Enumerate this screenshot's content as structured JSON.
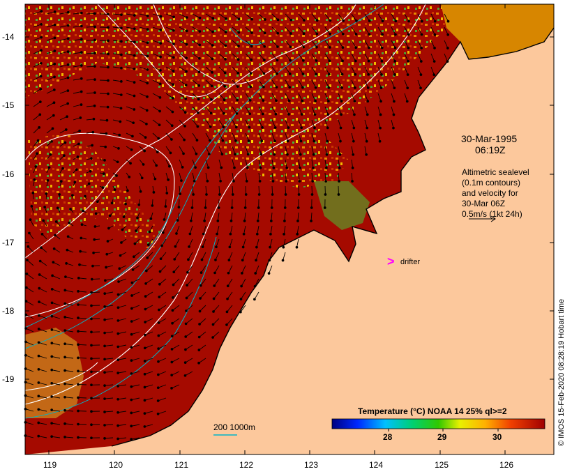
{
  "map": {
    "date": "30-Mar-1995",
    "time": "06:19Z",
    "legend_lines": [
      "Altimetric sealevel",
      "(0.1m contours)",
      "and velocity for",
      "30-Mar 06Z",
      "0.5m/s (1kt 24h)"
    ],
    "drifter_label": "drifter",
    "scale_label": "200  1000m",
    "credit": "© IMOS 15-Feb-2020 08:28:19 Hobart time",
    "colorbar": {
      "title": "Temperature (°C) NOAA 14 25% ql>=2",
      "ticks": [
        "28",
        "29",
        "30"
      ]
    },
    "lat_labels": [
      "-14",
      "-15",
      "-16",
      "-17",
      "-18",
      "-19"
    ],
    "lon_labels": [
      "119",
      "120",
      "121",
      "122",
      "123",
      "124",
      "125",
      "126"
    ],
    "colors": {
      "land": "#fcc89c",
      "sea_warm": "#a50a00",
      "contour": "#ffffff",
      "isobath": "#00b4c8",
      "drifter": "#ff00ff"
    }
  }
}
